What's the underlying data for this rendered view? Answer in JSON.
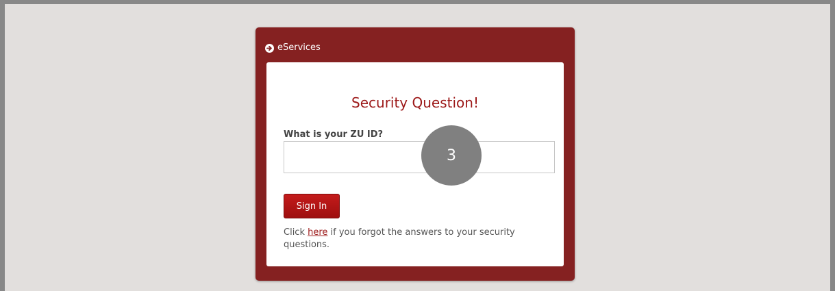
{
  "header": {
    "icon": "arrow-circle-right-icon",
    "title": "eServices"
  },
  "card": {
    "title": "Security Question!",
    "question_label": "What is your ZU ID?",
    "answer_value": "",
    "answer_placeholder": "",
    "step_marker": "3",
    "signin_label": "Sign In",
    "help": {
      "prefix": "Click ",
      "link": "here",
      "suffix": " if you forgot the answers to your security questions."
    }
  },
  "colors": {
    "panel": "#852121",
    "accent": "#9c1818",
    "background": "#e2dfdd",
    "frame": "#888888",
    "marker": "#808080"
  }
}
